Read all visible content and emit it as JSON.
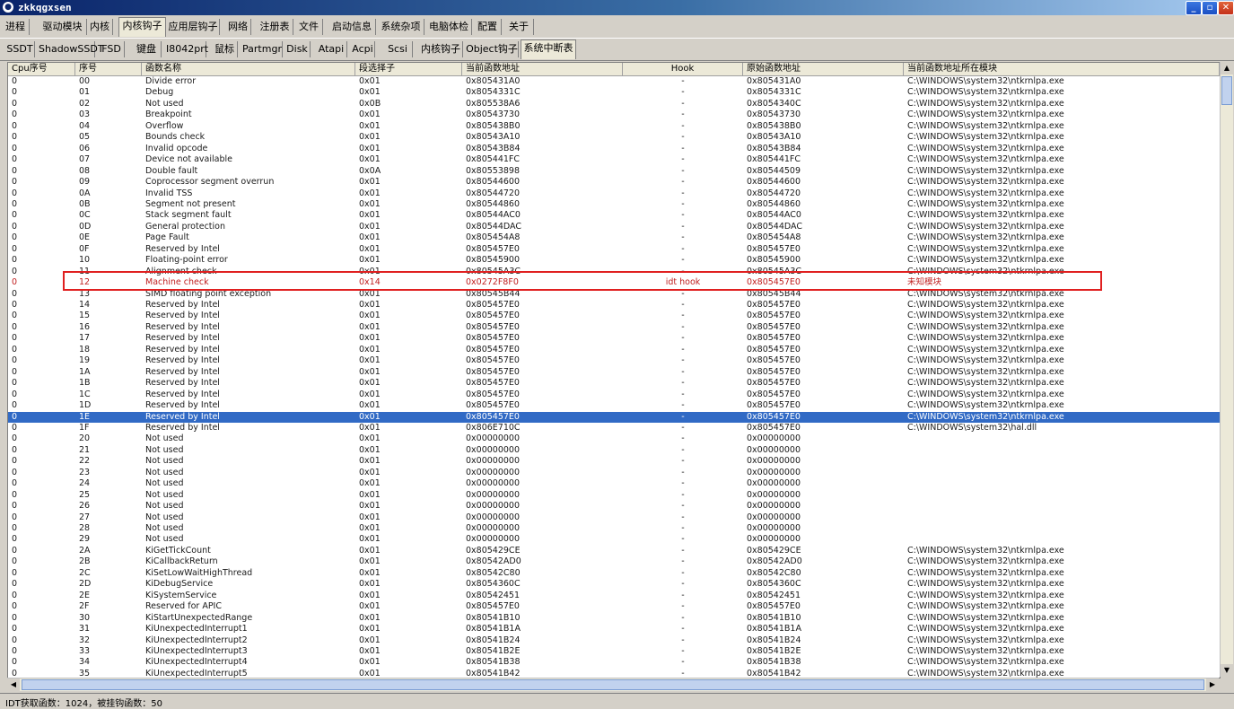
{
  "window": {
    "title": "zkkqgxsen"
  },
  "tabs_row1": [
    "进程",
    "驱动模块",
    "内核",
    "内核钩子",
    "应用层钩子",
    "网络",
    "注册表",
    "文件",
    "启动信息",
    "系统杂项",
    "电脑体检",
    "配置",
    "关于"
  ],
  "tabs_row1_active": "内核钩子",
  "tabs_row2": [
    "SSDT",
    "ShadowSSDT",
    "FSD",
    "键盘",
    "I8042prt",
    "鼠标",
    "Partmgr",
    "Disk",
    "Atapi",
    "Acpi",
    "Scsi",
    "内核钩子",
    "Object钩子",
    "系统中断表"
  ],
  "tabs_row2_active": "系统中断表",
  "columns": [
    "Cpu序号",
    "序号",
    "函数名称",
    "段选择子",
    "当前函数地址",
    "Hook",
    "原始函数地址",
    "当前函数地址所在模块"
  ],
  "rows": [
    [
      "0",
      "00",
      "Divide error",
      "0x01",
      "0x805431A0",
      "-",
      "0x805431A0",
      "C:\\WINDOWS\\system32\\ntkrnlpa.exe"
    ],
    [
      "0",
      "01",
      "Debug",
      "0x01",
      "0x8054331C",
      "-",
      "0x8054331C",
      "C:\\WINDOWS\\system32\\ntkrnlpa.exe"
    ],
    [
      "0",
      "02",
      "Not used",
      "0x0B",
      "0x805538A6",
      "-",
      "0x8054340C",
      "C:\\WINDOWS\\system32\\ntkrnlpa.exe"
    ],
    [
      "0",
      "03",
      "Breakpoint",
      "0x01",
      "0x80543730",
      "-",
      "0x80543730",
      "C:\\WINDOWS\\system32\\ntkrnlpa.exe"
    ],
    [
      "0",
      "04",
      "Overflow",
      "0x01",
      "0x805438B0",
      "-",
      "0x805438B0",
      "C:\\WINDOWS\\system32\\ntkrnlpa.exe"
    ],
    [
      "0",
      "05",
      "Bounds check",
      "0x01",
      "0x80543A10",
      "-",
      "0x80543A10",
      "C:\\WINDOWS\\system32\\ntkrnlpa.exe"
    ],
    [
      "0",
      "06",
      "Invalid opcode",
      "0x01",
      "0x80543B84",
      "-",
      "0x80543B84",
      "C:\\WINDOWS\\system32\\ntkrnlpa.exe"
    ],
    [
      "0",
      "07",
      "Device not available",
      "0x01",
      "0x805441FC",
      "-",
      "0x805441FC",
      "C:\\WINDOWS\\system32\\ntkrnlpa.exe"
    ],
    [
      "0",
      "08",
      "Double fault",
      "0x0A",
      "0x80553898",
      "-",
      "0x80544509",
      "C:\\WINDOWS\\system32\\ntkrnlpa.exe"
    ],
    [
      "0",
      "09",
      "Coprocessor segment overrun",
      "0x01",
      "0x80544600",
      "-",
      "0x80544600",
      "C:\\WINDOWS\\system32\\ntkrnlpa.exe"
    ],
    [
      "0",
      "0A",
      "Invalid TSS",
      "0x01",
      "0x80544720",
      "-",
      "0x80544720",
      "C:\\WINDOWS\\system32\\ntkrnlpa.exe"
    ],
    [
      "0",
      "0B",
      "Segment not present",
      "0x01",
      "0x80544860",
      "-",
      "0x80544860",
      "C:\\WINDOWS\\system32\\ntkrnlpa.exe"
    ],
    [
      "0",
      "0C",
      "Stack segment fault",
      "0x01",
      "0x80544AC0",
      "-",
      "0x80544AC0",
      "C:\\WINDOWS\\system32\\ntkrnlpa.exe"
    ],
    [
      "0",
      "0D",
      "General protection",
      "0x01",
      "0x80544DAC",
      "-",
      "0x80544DAC",
      "C:\\WINDOWS\\system32\\ntkrnlpa.exe"
    ],
    [
      "0",
      "0E",
      "Page Fault",
      "0x01",
      "0x805454A8",
      "-",
      "0x805454A8",
      "C:\\WINDOWS\\system32\\ntkrnlpa.exe"
    ],
    [
      "0",
      "0F",
      "Reserved by Intel",
      "0x01",
      "0x805457E0",
      "-",
      "0x805457E0",
      "C:\\WINDOWS\\system32\\ntkrnlpa.exe"
    ],
    [
      "0",
      "10",
      "Floating-point error",
      "0x01",
      "0x80545900",
      "-",
      "0x80545900",
      "C:\\WINDOWS\\system32\\ntkrnlpa.exe"
    ],
    [
      "0",
      "11",
      "Alignment check",
      "0x01",
      "0x80545A3C",
      "-",
      "0x80545A3C",
      "C:\\WINDOWS\\system32\\ntkrnlpa.exe"
    ],
    [
      "0",
      "12",
      "Machine check",
      "0x14",
      "0x0272F8F0",
      "idt hook",
      "0x805457E0",
      "未知模块"
    ],
    [
      "0",
      "13",
      "SIMD floating point exception",
      "0x01",
      "0x80545B44",
      "-",
      "0x80545B44",
      "C:\\WINDOWS\\system32\\ntkrnlpa.exe"
    ],
    [
      "0",
      "14",
      "Reserved by Intel",
      "0x01",
      "0x805457E0",
      "-",
      "0x805457E0",
      "C:\\WINDOWS\\system32\\ntkrnlpa.exe"
    ],
    [
      "0",
      "15",
      "Reserved by Intel",
      "0x01",
      "0x805457E0",
      "-",
      "0x805457E0",
      "C:\\WINDOWS\\system32\\ntkrnlpa.exe"
    ],
    [
      "0",
      "16",
      "Reserved by Intel",
      "0x01",
      "0x805457E0",
      "-",
      "0x805457E0",
      "C:\\WINDOWS\\system32\\ntkrnlpa.exe"
    ],
    [
      "0",
      "17",
      "Reserved by Intel",
      "0x01",
      "0x805457E0",
      "-",
      "0x805457E0",
      "C:\\WINDOWS\\system32\\ntkrnlpa.exe"
    ],
    [
      "0",
      "18",
      "Reserved by Intel",
      "0x01",
      "0x805457E0",
      "-",
      "0x805457E0",
      "C:\\WINDOWS\\system32\\ntkrnlpa.exe"
    ],
    [
      "0",
      "19",
      "Reserved by Intel",
      "0x01",
      "0x805457E0",
      "-",
      "0x805457E0",
      "C:\\WINDOWS\\system32\\ntkrnlpa.exe"
    ],
    [
      "0",
      "1A",
      "Reserved by Intel",
      "0x01",
      "0x805457E0",
      "-",
      "0x805457E0",
      "C:\\WINDOWS\\system32\\ntkrnlpa.exe"
    ],
    [
      "0",
      "1B",
      "Reserved by Intel",
      "0x01",
      "0x805457E0",
      "-",
      "0x805457E0",
      "C:\\WINDOWS\\system32\\ntkrnlpa.exe"
    ],
    [
      "0",
      "1C",
      "Reserved by Intel",
      "0x01",
      "0x805457E0",
      "-",
      "0x805457E0",
      "C:\\WINDOWS\\system32\\ntkrnlpa.exe"
    ],
    [
      "0",
      "1D",
      "Reserved by Intel",
      "0x01",
      "0x805457E0",
      "-",
      "0x805457E0",
      "C:\\WINDOWS\\system32\\ntkrnlpa.exe"
    ],
    [
      "0",
      "1E",
      "Reserved by Intel",
      "0x01",
      "0x805457E0",
      "-",
      "0x805457E0",
      "C:\\WINDOWS\\system32\\ntkrnlpa.exe"
    ],
    [
      "0",
      "1F",
      "Reserved by Intel",
      "0x01",
      "0x806E710C",
      "-",
      "0x805457E0",
      "C:\\WINDOWS\\system32\\hal.dll"
    ],
    [
      "0",
      "20",
      "Not used",
      "0x01",
      "0x00000000",
      "-",
      "0x00000000",
      ""
    ],
    [
      "0",
      "21",
      "Not used",
      "0x01",
      "0x00000000",
      "-",
      "0x00000000",
      ""
    ],
    [
      "0",
      "22",
      "Not used",
      "0x01",
      "0x00000000",
      "-",
      "0x00000000",
      ""
    ],
    [
      "0",
      "23",
      "Not used",
      "0x01",
      "0x00000000",
      "-",
      "0x00000000",
      ""
    ],
    [
      "0",
      "24",
      "Not used",
      "0x01",
      "0x00000000",
      "-",
      "0x00000000",
      ""
    ],
    [
      "0",
      "25",
      "Not used",
      "0x01",
      "0x00000000",
      "-",
      "0x00000000",
      ""
    ],
    [
      "0",
      "26",
      "Not used",
      "0x01",
      "0x00000000",
      "-",
      "0x00000000",
      ""
    ],
    [
      "0",
      "27",
      "Not used",
      "0x01",
      "0x00000000",
      "-",
      "0x00000000",
      ""
    ],
    [
      "0",
      "28",
      "Not used",
      "0x01",
      "0x00000000",
      "-",
      "0x00000000",
      ""
    ],
    [
      "0",
      "29",
      "Not used",
      "0x01",
      "0x00000000",
      "-",
      "0x00000000",
      ""
    ],
    [
      "0",
      "2A",
      "KiGetTickCount",
      "0x01",
      "0x805429CE",
      "-",
      "0x805429CE",
      "C:\\WINDOWS\\system32\\ntkrnlpa.exe"
    ],
    [
      "0",
      "2B",
      "KiCallbackReturn",
      "0x01",
      "0x80542AD0",
      "-",
      "0x80542AD0",
      "C:\\WINDOWS\\system32\\ntkrnlpa.exe"
    ],
    [
      "0",
      "2C",
      "KiSetLowWaitHighThread",
      "0x01",
      "0x80542C80",
      "-",
      "0x80542C80",
      "C:\\WINDOWS\\system32\\ntkrnlpa.exe"
    ],
    [
      "0",
      "2D",
      "KiDebugService",
      "0x01",
      "0x8054360C",
      "-",
      "0x8054360C",
      "C:\\WINDOWS\\system32\\ntkrnlpa.exe"
    ],
    [
      "0",
      "2E",
      "KiSystemService",
      "0x01",
      "0x80542451",
      "-",
      "0x80542451",
      "C:\\WINDOWS\\system32\\ntkrnlpa.exe"
    ],
    [
      "0",
      "2F",
      "Reserved for APIC",
      "0x01",
      "0x805457E0",
      "-",
      "0x805457E0",
      "C:\\WINDOWS\\system32\\ntkrnlpa.exe"
    ],
    [
      "0",
      "30",
      "KiStartUnexpectedRange",
      "0x01",
      "0x80541B10",
      "-",
      "0x80541B10",
      "C:\\WINDOWS\\system32\\ntkrnlpa.exe"
    ],
    [
      "0",
      "31",
      "KiUnexpectedInterrupt1",
      "0x01",
      "0x80541B1A",
      "-",
      "0x80541B1A",
      "C:\\WINDOWS\\system32\\ntkrnlpa.exe"
    ],
    [
      "0",
      "32",
      "KiUnexpectedInterrupt2",
      "0x01",
      "0x80541B24",
      "-",
      "0x80541B24",
      "C:\\WINDOWS\\system32\\ntkrnlpa.exe"
    ],
    [
      "0",
      "33",
      "KiUnexpectedInterrupt3",
      "0x01",
      "0x80541B2E",
      "-",
      "0x80541B2E",
      "C:\\WINDOWS\\system32\\ntkrnlpa.exe"
    ],
    [
      "0",
      "34",
      "KiUnexpectedInterrupt4",
      "0x01",
      "0x80541B38",
      "-",
      "0x80541B38",
      "C:\\WINDOWS\\system32\\ntkrnlpa.exe"
    ],
    [
      "0",
      "35",
      "KiUnexpectedInterrupt5",
      "0x01",
      "0x80541B42",
      "-",
      "0x80541B42",
      "C:\\WINDOWS\\system32\\ntkrnlpa.exe"
    ]
  ],
  "hooked_row_index": 18,
  "selected_row_index": 30,
  "status": {
    "text": "IDT获取函数：1024，被挂钩函数：50"
  },
  "colors": {
    "hook_text": "#c02020",
    "selection": "#316ac5",
    "highlight_border": "#e02020"
  }
}
